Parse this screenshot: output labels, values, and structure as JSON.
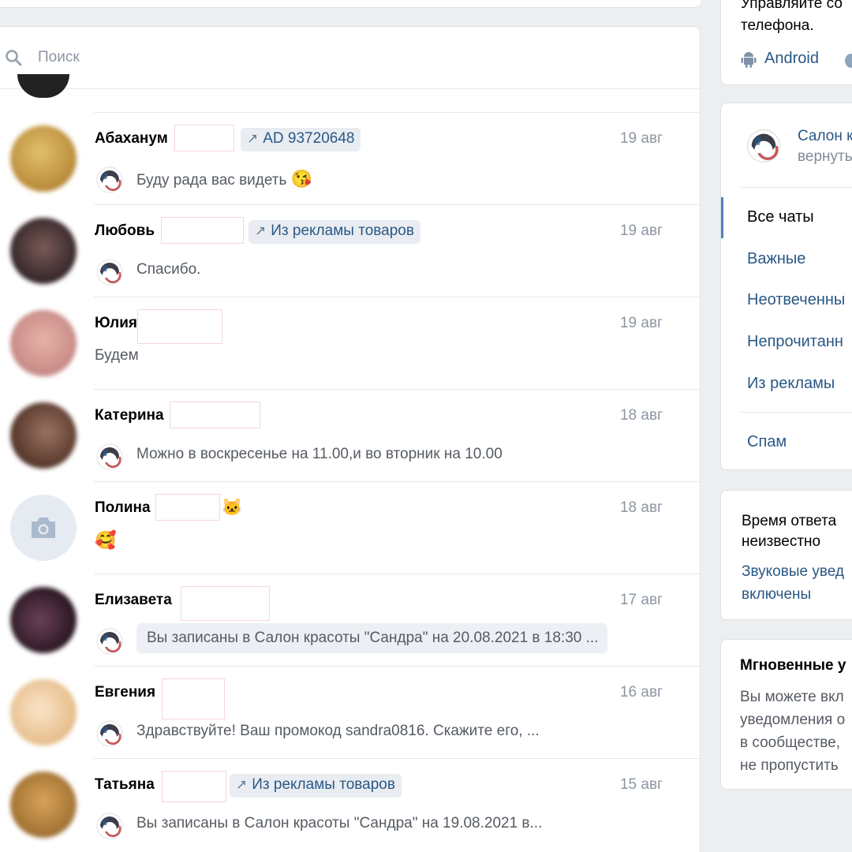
{
  "search": {
    "placeholder": "Поиск"
  },
  "dialogs": [
    {
      "name": "Абаханум",
      "tag": "AD 93720648",
      "date": "19 авг",
      "message": "Буду рада вас видеть",
      "emoji": "😘",
      "avatar_color": "#c9a24a"
    },
    {
      "name": "Любовь",
      "tag": "Из рекламы товаров",
      "date": "19 авг",
      "message": "Спасибо.",
      "avatar_color": "#4a3a3d"
    },
    {
      "name": "Юлия",
      "date": "19 авг",
      "message": "Будем",
      "avatar_color": "#d49a93"
    },
    {
      "name": "Катерина",
      "date": "18 авг",
      "message": "Можно в воскресенье на 11.00,и во вторник на 10.00",
      "avatar_color": "#6a4a3a"
    },
    {
      "name": "Полина",
      "name_emoji": "🐱",
      "date": "18 авг",
      "emoji": "🥰",
      "avatar_color": "#e5ebf1"
    },
    {
      "name": "Елизавета",
      "date": "17 авг",
      "message": "Вы записаны в Салон красоты \"Сандра\" на 20.08.2021 в 18:30 ...",
      "avatar_color": "#3b2530"
    },
    {
      "name": "Евгения",
      "date": "16 авг",
      "message": "Здравствуйте! Ваш промокод sandra0816. Скажите его, ...",
      "avatar_color": "#e8c6a0"
    },
    {
      "name": "Татьяна",
      "tag": "Из рекламы товаров",
      "date": "15 авг",
      "message": "Вы записаны в Салон красоты \"Сандра\" на 19.08.2021 в...",
      "avatar_color": "#b8873e"
    }
  ],
  "sidebar": {
    "app_card": {
      "line1": "Управляйте со",
      "line2": "телефона.",
      "android": "Android"
    },
    "group": {
      "title": "Салон к",
      "subtitle": "вернуть"
    },
    "filters": [
      {
        "label": "Все чаты",
        "active": true
      },
      {
        "label": "Важные"
      },
      {
        "label": "Неотвеченны"
      },
      {
        "label": "Непрочитанн"
      },
      {
        "label": "Из рекламы"
      },
      {
        "label": "Спам"
      }
    ],
    "response": {
      "line1": "Время ответа",
      "line2": "неизвестно",
      "link1": "Звуковые увед",
      "link2": "включены"
    },
    "instant": {
      "title": "Мгновенные у",
      "lines": [
        "Вы можете вкл",
        "уведомления о",
        "в сообществе,",
        "не пропустить"
      ]
    }
  },
  "colors": {
    "link": "#2a5885",
    "muted": "#8d96a1",
    "accent": "#5181b8"
  }
}
